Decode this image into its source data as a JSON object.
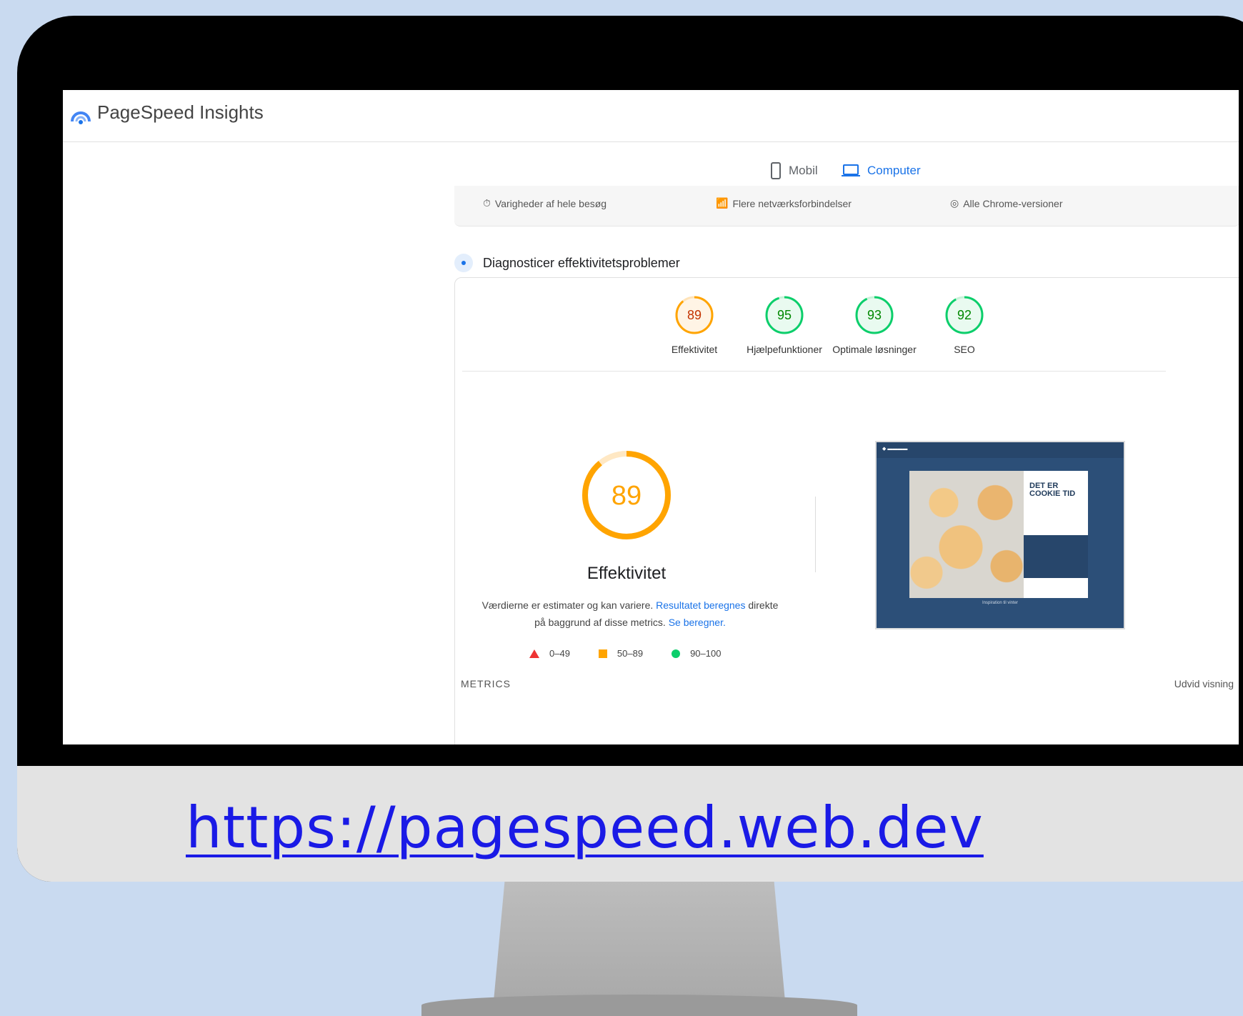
{
  "app": {
    "title": "PageSpeed Insights"
  },
  "tabs": [
    {
      "label": "Mobil",
      "icon": "phone-icon",
      "active": false
    },
    {
      "label": "Computer",
      "icon": "laptop-icon",
      "active": true
    }
  ],
  "info_bar": {
    "duration": "Varigheder af hele besøg",
    "network": "Flere netværksforbindelser",
    "chrome": "Alle Chrome-versioner"
  },
  "diagnose": {
    "title": "Diagnosticer effektivitetsproblemer"
  },
  "scores": [
    {
      "value": "89",
      "label": "Effektivitet",
      "status": "average",
      "color": "#ffa400",
      "text_color": "#c33300"
    },
    {
      "value": "95",
      "label": "Hjælpefunktioner",
      "status": "good",
      "color": "#0cce6b",
      "text_color": "#008800"
    },
    {
      "value": "93",
      "label": "Optimale løsninger",
      "status": "good",
      "color": "#0cce6b",
      "text_color": "#008800"
    },
    {
      "value": "92",
      "label": "SEO",
      "status": "good",
      "color": "#0cce6b",
      "text_color": "#008800"
    }
  ],
  "main_score": {
    "value": "89",
    "label": "Effektivitet",
    "color": "#ffa400"
  },
  "explain": {
    "text1": "Værdierne er estimater og kan variere.",
    "link1": "Resultatet beregnes",
    "text2": "direkte på baggrund af disse metrics.",
    "link2": "Se beregner."
  },
  "legend": {
    "low": "0–49",
    "mid": "50–89",
    "high": "90–100"
  },
  "screenshot": {
    "cookie_title": "DET ER COOKIE TID",
    "caption": "Inspiration til vinter"
  },
  "metrics": {
    "title": "METRICS",
    "expand": "Udvid visning"
  },
  "caption": {
    "url": "https://pagespeed.web.dev"
  },
  "colors": {
    "accent": "#1a73e8",
    "average": "#ffa400",
    "good": "#0cce6b",
    "poor": "#ff3333"
  }
}
